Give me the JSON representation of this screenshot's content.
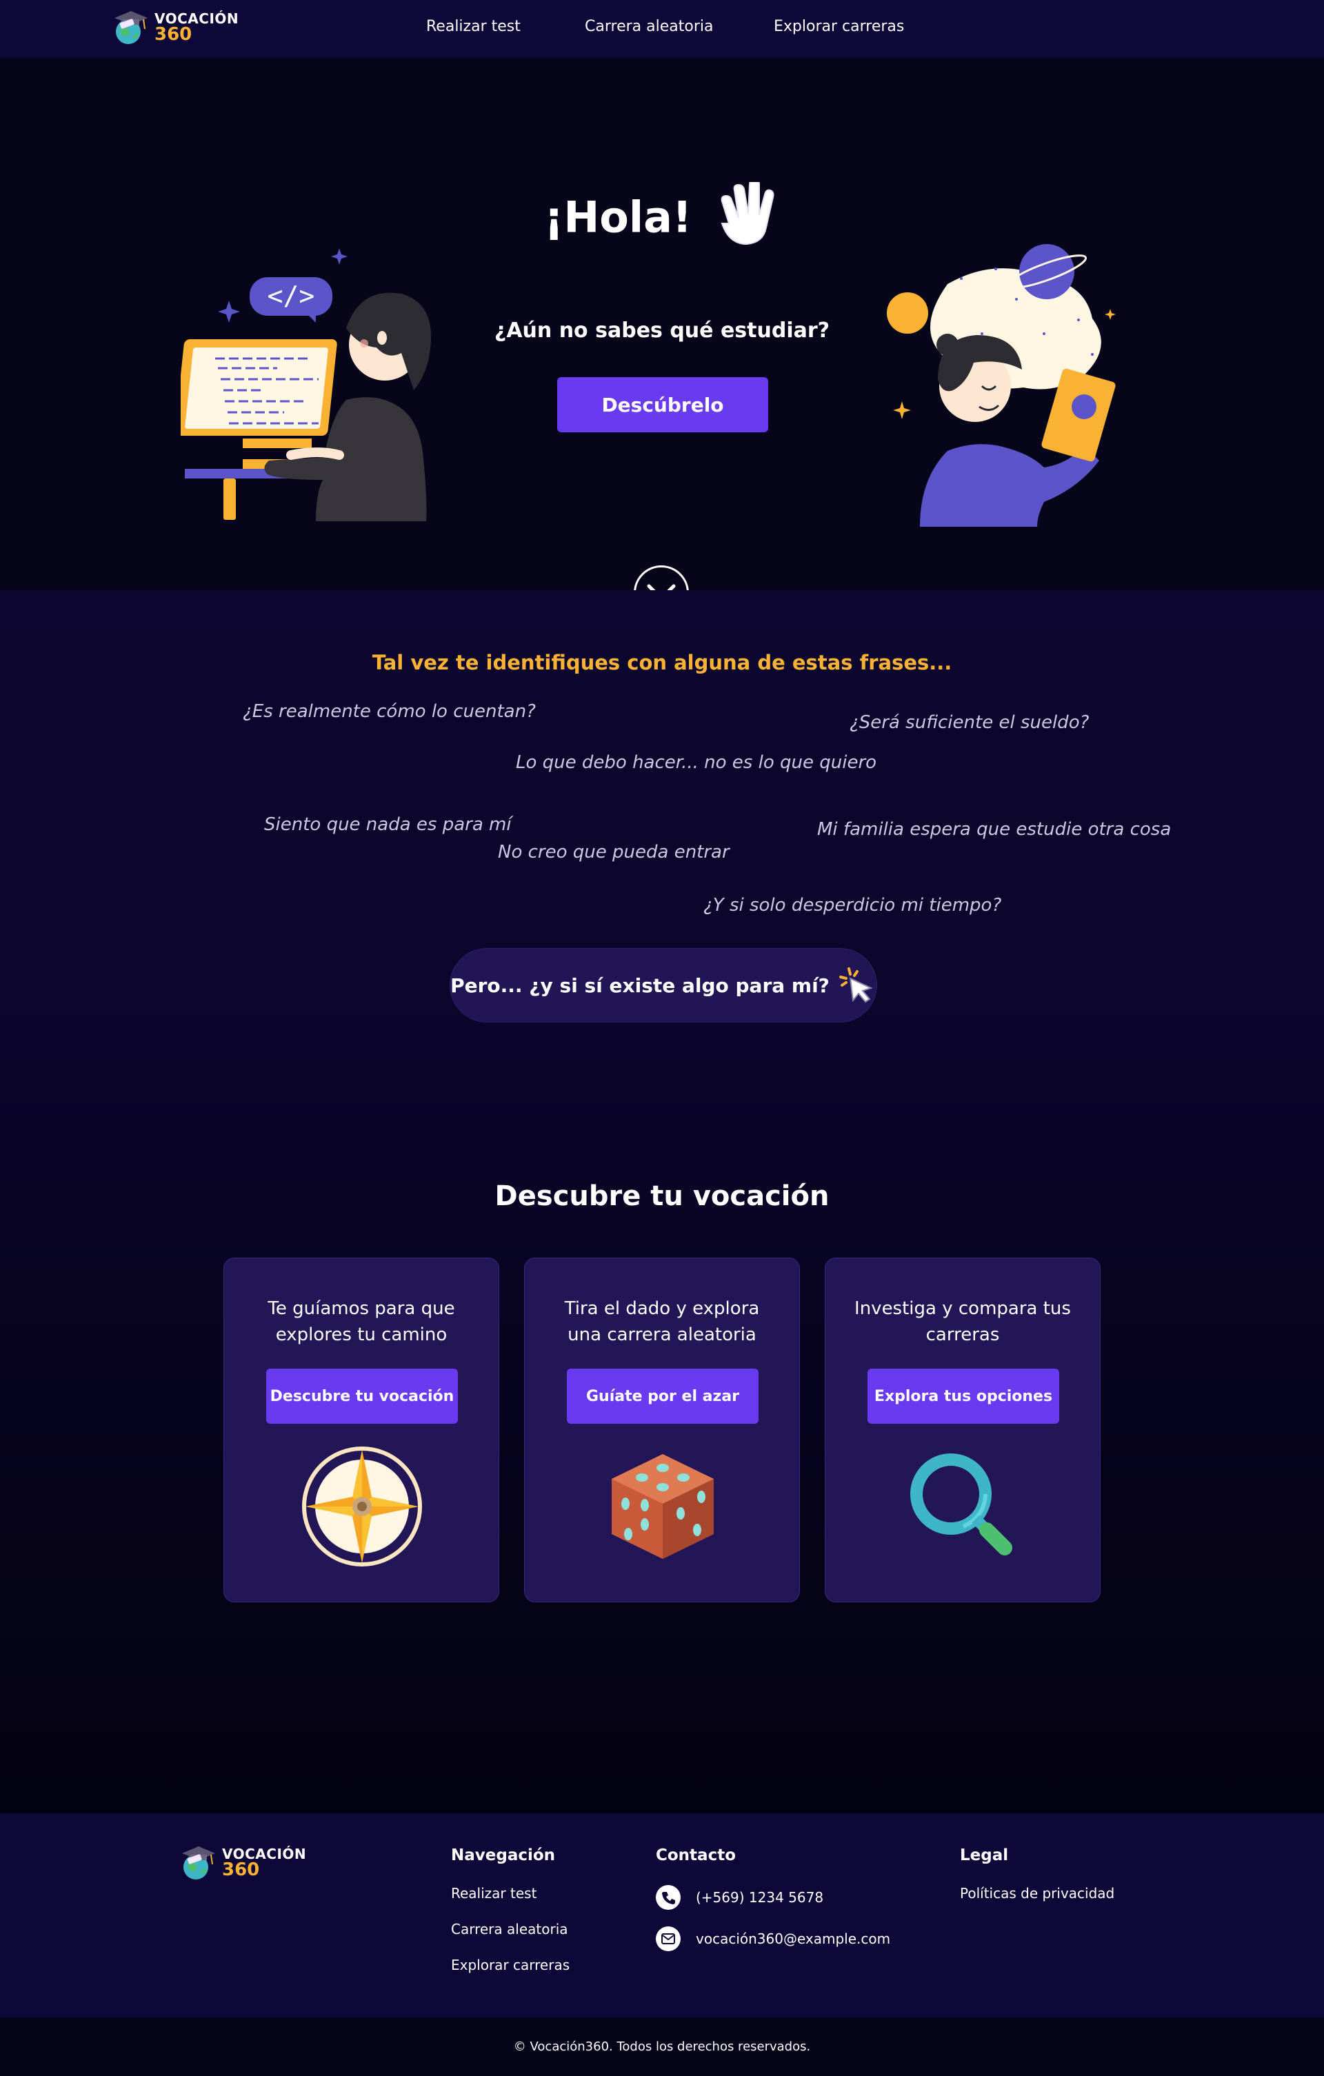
{
  "brand": {
    "line1": "VOCACIÓN",
    "line2": "360"
  },
  "nav": {
    "items": [
      "Realizar test",
      "Carrera aleatoria",
      "Explorar carreras"
    ]
  },
  "hero": {
    "title": "¡Hola!",
    "subtitle": "¿Aún no sabes qué estudiar?",
    "button": "Descúbrelo"
  },
  "phrases": {
    "title": "Tal vez te identifiques con alguna de estas frases...",
    "items": [
      "¿Es realmente cómo lo cuentan?",
      "¿Será suficiente el sueldo?",
      "Lo que debo hacer... no es lo que quiero",
      "Siento que nada es para mí",
      "Mi familia espera que estudie otra cosa",
      "No creo que pueda entrar",
      "¿Y si solo desperdicio mi tiempo?"
    ],
    "cta": "Pero... ¿y si sí existe algo para mí?"
  },
  "discover": {
    "title": "Descubre tu vocación",
    "cards": [
      {
        "text": "Te guíamos para que explores tu camino",
        "button": "Descubre tu vocación",
        "icon": "compass-icon"
      },
      {
        "text": "Tira el dado y explora una carrera aleatoria",
        "button": "Guíate por el azar",
        "icon": "dice-icon"
      },
      {
        "text": "Investiga y compara tus carreras",
        "button": "Explora tus opciones",
        "icon": "magnifier-icon"
      }
    ]
  },
  "footer": {
    "nav_title": "Navegación",
    "nav_links": [
      "Realizar test",
      "Carrera aleatoria",
      "Explorar carreras"
    ],
    "contact_title": "Contacto",
    "phone": "(+569) 1234 5678",
    "email": "vocación360@example.com",
    "legal_title": "Legal",
    "legal_links": [
      "Políticas de privacidad"
    ],
    "copyright": "© Vocación360. Todos los derechos reservados."
  },
  "colors": {
    "accent": "#6a3af0",
    "brand_yellow": "#f9b233",
    "nav_bg": "#0e0838",
    "card_bg": "#221657"
  }
}
